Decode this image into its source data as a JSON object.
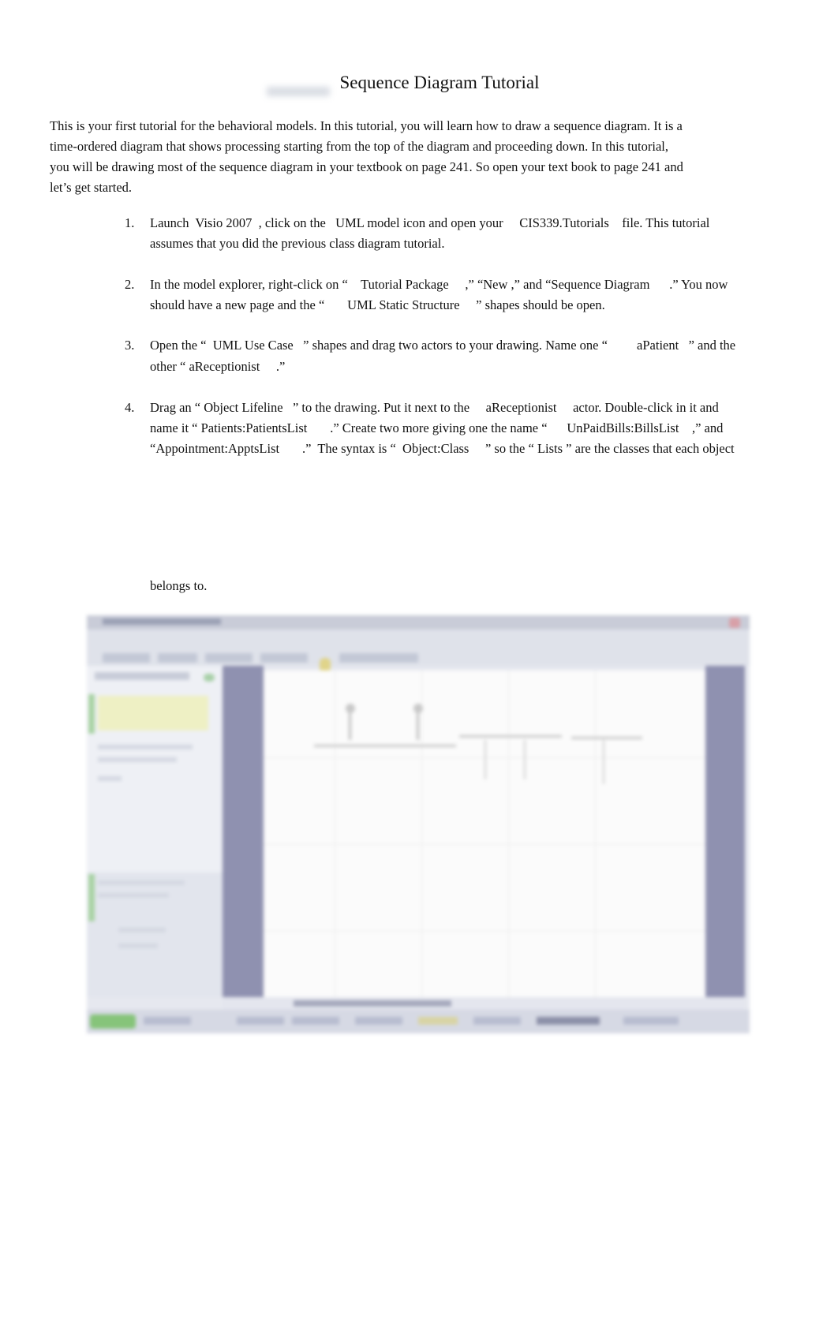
{
  "document": {
    "title": "Sequence Diagram Tutorial",
    "intro_lines": [
      "This is your first tutorial for the behavioral models. In this tutorial, you will learn how to draw a sequence diagram. It is a",
      "time-ordered diagram that shows processing starting from the top of the diagram and proceeding down. In this tutorial,",
      "you will be drawing most of the sequence diagram in your textbook on page 241. So open your text book to page 241 and",
      "let’s get started."
    ],
    "steps": [
      {
        "number": "1.",
        "lines": [
          "Launch  Visio 2007  , click on the   UML model icon and open your     CIS339.Tutorials    file. This tutorial",
          "assumes that you did the previous class diagram tutorial."
        ]
      },
      {
        "number": "2.",
        "lines": [
          "In the model explorer, right-click on “    Tutorial Package     ,” “New ,” and “Sequence Diagram      .” You now",
          "should have a new page and the “       UML Static Structure     ” shapes should be open."
        ]
      },
      {
        "number": "3.",
        "lines": [
          "Open the “  UML Use Case   ” shapes and drag two actors to your drawing. Name one “         aPatient   ” and the",
          "other “ aReceptionist     .”"
        ]
      },
      {
        "number": "4.",
        "lines": [
          "Drag an “ Object Lifeline   ” to the drawing. Put it next to the     aReceptionist     actor. Double-click in it and",
          "name it “ Patients:PatientsList       .” Create two more giving one the name “      UnPaidBills:BillsList    ,” and",
          "“Appointment:ApptsList       .”  The syntax is “  Object:Class     ” so the “ Lists ” are the classes that each object"
        ],
        "continuation": "belongs to."
      }
    ],
    "embedded_screenshot": {
      "description": "Visio 2007 window showing a sequence diagram with two actors and object lifelines",
      "icons": [
        "close-icon",
        "start-button",
        "actor-icon",
        "lifeline"
      ]
    }
  }
}
